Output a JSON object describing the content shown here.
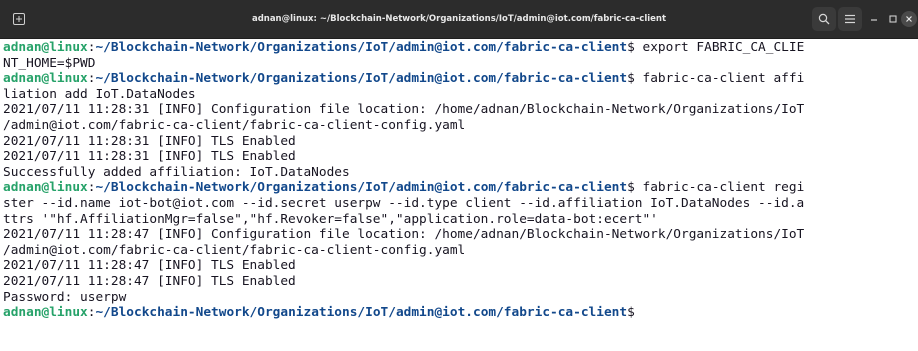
{
  "window": {
    "title": "adnan@linux: ~/Blockchain-Network/Organizations/IoT/admin@iot.com/fabric-ca-client"
  },
  "colors": {
    "titlebar": "#2c2c2c",
    "prompt_user": "#26a269",
    "prompt_path": "#12488b",
    "text": "#171421",
    "background": "#ffffff"
  },
  "icons": {
    "new_tab": "new-tab-icon",
    "search": "search-icon",
    "menu": "hamburger-menu-icon",
    "minimize": "minimize-icon",
    "maximize": "maximize-icon",
    "close": "close-icon"
  },
  "terminal": {
    "lines": [
      {
        "type": "prompt",
        "user": "adnan@linux",
        "sep": ":",
        "path": "~/Blockchain-Network/Organizations/IoT/admin@iot.com/fabric-ca-client",
        "cmd": "$ export FABRIC_CA_CLIE"
      },
      {
        "type": "text",
        "text": "NT_HOME=$PWD"
      },
      {
        "type": "prompt",
        "user": "adnan@linux",
        "sep": ":",
        "path": "~/Blockchain-Network/Organizations/IoT/admin@iot.com/fabric-ca-client",
        "cmd": "$ fabric-ca-client affi"
      },
      {
        "type": "text",
        "text": "liation add IoT.DataNodes"
      },
      {
        "type": "text",
        "text": "2021/07/11 11:28:31 [INFO] Configuration file location: /home/adnan/Blockchain-Network/Organizations/IoT"
      },
      {
        "type": "text",
        "text": "/admin@iot.com/fabric-ca-client/fabric-ca-client-config.yaml"
      },
      {
        "type": "text",
        "text": "2021/07/11 11:28:31 [INFO] TLS Enabled"
      },
      {
        "type": "text",
        "text": "2021/07/11 11:28:31 [INFO] TLS Enabled"
      },
      {
        "type": "text",
        "text": "Successfully added affiliation: IoT.DataNodes"
      },
      {
        "type": "prompt",
        "user": "adnan@linux",
        "sep": ":",
        "path": "~/Blockchain-Network/Organizations/IoT/admin@iot.com/fabric-ca-client",
        "cmd": "$ fabric-ca-client regi"
      },
      {
        "type": "text",
        "text": "ster --id.name iot-bot@iot.com --id.secret userpw --id.type client --id.affiliation IoT.DataNodes --id.a"
      },
      {
        "type": "text",
        "text": "ttrs '\"hf.AffiliationMgr=false\",\"hf.Revoker=false\",\"application.role=data-bot:ecert\"'"
      },
      {
        "type": "text",
        "text": "2021/07/11 11:28:47 [INFO] Configuration file location: /home/adnan/Blockchain-Network/Organizations/IoT"
      },
      {
        "type": "text",
        "text": "/admin@iot.com/fabric-ca-client/fabric-ca-client-config.yaml"
      },
      {
        "type": "text",
        "text": "2021/07/11 11:28:47 [INFO] TLS Enabled"
      },
      {
        "type": "text",
        "text": "2021/07/11 11:28:47 [INFO] TLS Enabled"
      },
      {
        "type": "text",
        "text": "Password: userpw"
      },
      {
        "type": "prompt",
        "user": "adnan@linux",
        "sep": ":",
        "path": "~/Blockchain-Network/Organizations/IoT/admin@iot.com/fabric-ca-client",
        "cmd": "$"
      }
    ]
  }
}
